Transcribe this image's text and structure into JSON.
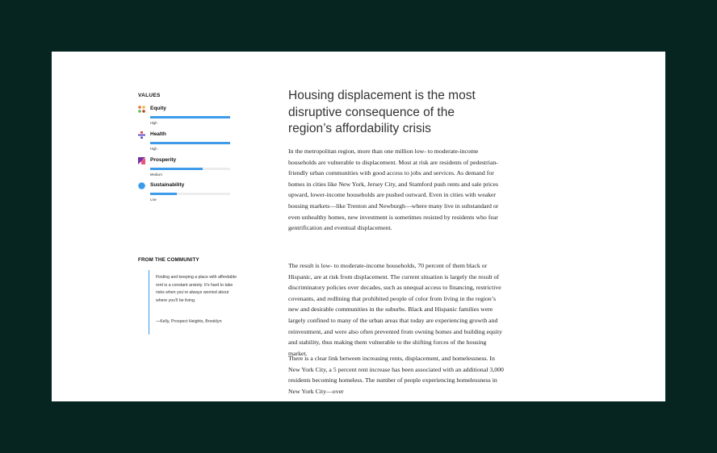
{
  "sidebar": {
    "values_heading": "VALUES",
    "values": [
      {
        "name": "Equity",
        "level": "High",
        "level_fraction": 1.0,
        "icon": "equity-grid-icon",
        "colors": [
          "#f26b38",
          "#f4b43a",
          "#58b947",
          "#c0392b"
        ]
      },
      {
        "name": "Health",
        "level": "High",
        "level_fraction": 1.0,
        "icon": "health-divide-icon",
        "colors": [
          "#e53b3b",
          "#6e4fc4"
        ]
      },
      {
        "name": "Prosperity",
        "level": "Medium",
        "level_fraction": 0.66,
        "icon": "prosperity-triangle-icon",
        "colors": [
          "#7a2f9e",
          "#e8547a"
        ]
      },
      {
        "name": "Sustainability",
        "level": "Low",
        "level_fraction": 0.33,
        "icon": "sustainability-circle-icon",
        "colors": [
          "#3d9be9"
        ]
      }
    ],
    "community_heading": "FROM THE COMMUNITY",
    "quote": "Finding and keeping a place with affordable rent is a constant anxiety. It’s hard to take risks when you’re always worried about where you’ll be living.",
    "quote_attribution": "—Kelly, Prospect Heights, Brooklyn"
  },
  "article": {
    "title": "Housing displacement is the most disruptive consequence of the region’s affordability crisis",
    "paragraphs": [
      "In the metropolitan region, more than one million low- to moderate-income households are vulnerable to displacement. Most at risk are residents of pedestrian-friendly urban communities with good access to jobs and services. As demand for homes in cities like New York, Jersey City, and Stamford push rents and sale prices upward, lower-income households are pushed outward. Even in cities with weaker housing markets—like Trenton and Newburgh—where many live in substandard or even unhealthy homes, new investment is sometimes resisted by residents who fear gentrification and eventual displacement.",
      "The result is low- to moderate-income households, 70 percent of them black or Hispanic, are at risk from displacement. The current situation is largely the result of discriminatory policies over decades, such as unequal access to financing, restrictive covenants, and redlining that prohibited people of color from living in the region’s new and desirable communities in the suburbs. Black and Hispanic families were largely confined to many of the urban areas that today are experiencing growth and reinvestment, and were also often prevented from owning homes and building equity and stability, thus making them vulnerable to the shifting forces of the housing market.",
      "There is a clear link between increasing rents, displacement, and homelessness. In New York City, a 5 percent rent increase has been associated with an additional 3,000 residents becoming homeless. The number of people experiencing homelessness in New York City—over"
    ]
  },
  "colors": {
    "background": "#062420",
    "bar_fill": "#3d9be9",
    "bar_track": "#ececec"
  }
}
